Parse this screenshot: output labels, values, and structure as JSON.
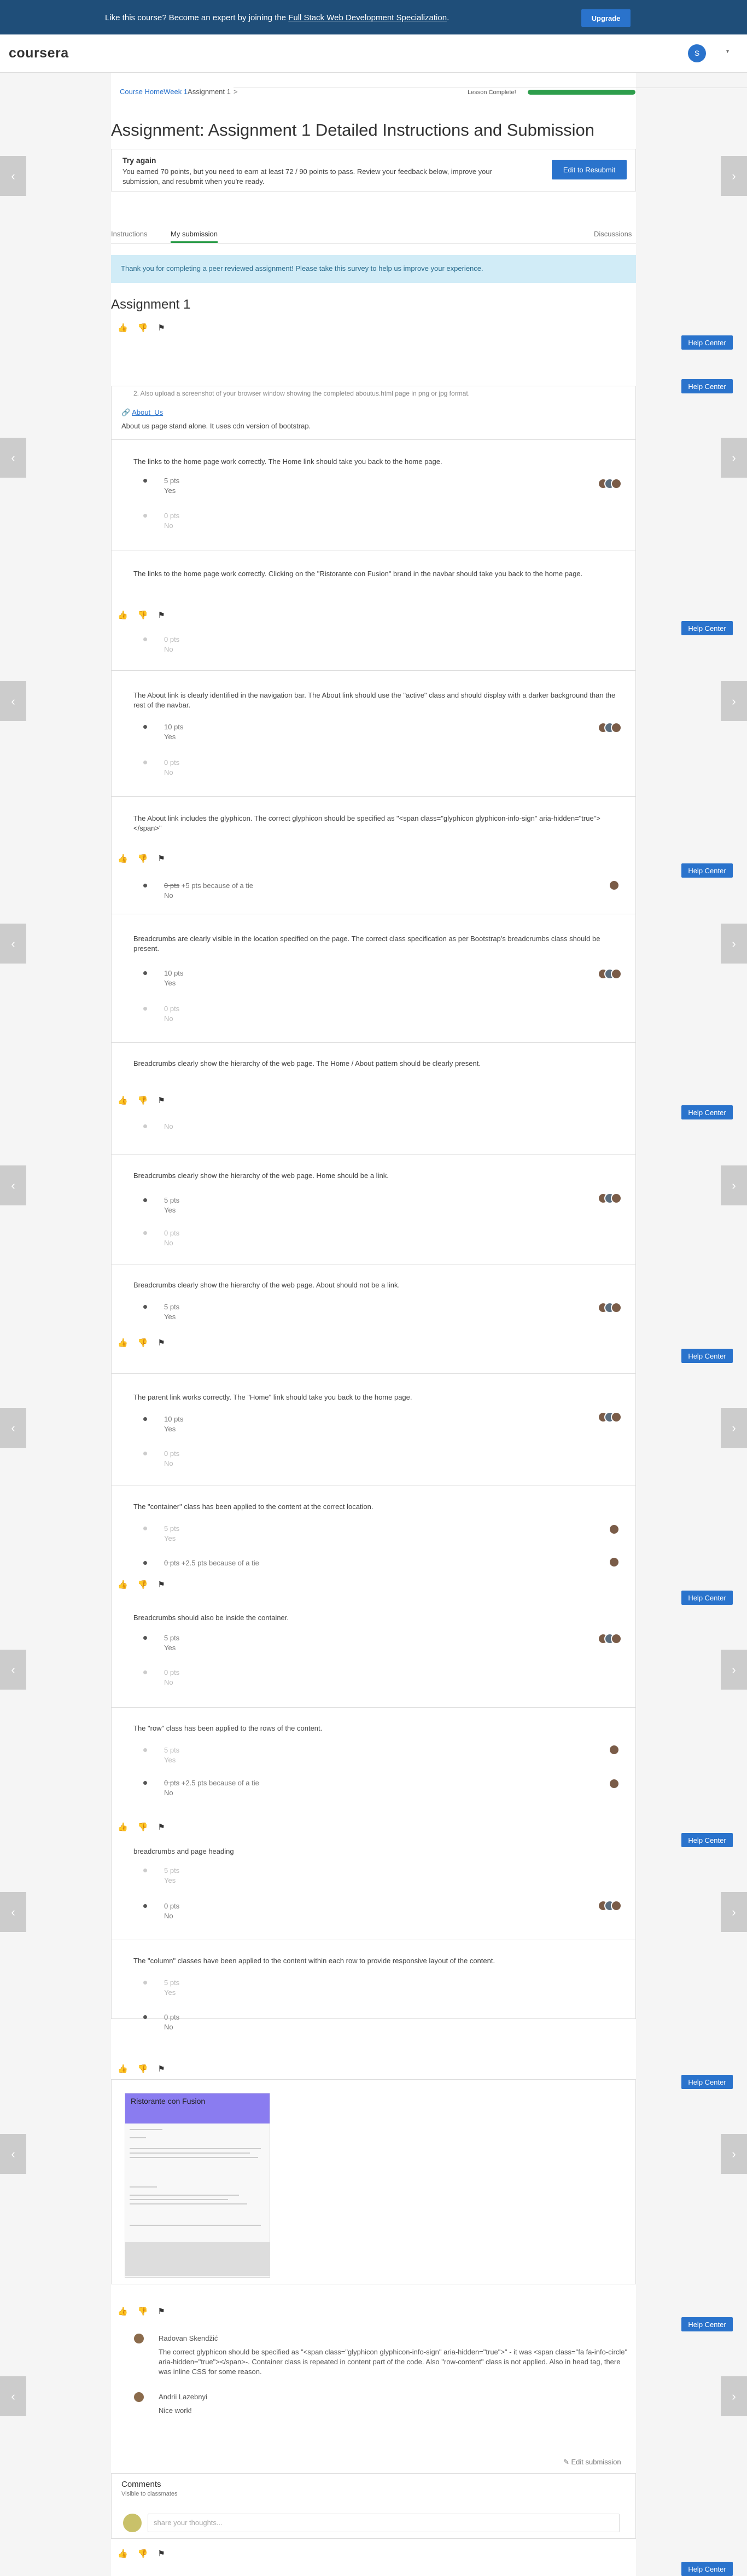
{
  "banner": {
    "text": "Like this course? Become an expert by joining the ",
    "link": "Full Stack Web Development Specialization",
    "end": ".",
    "upgrade": "Upgrade"
  },
  "nav": {
    "logo": "coursera",
    "avatar": "S",
    "caret": "▾"
  },
  "breadcrumb": {
    "home": "Course Home",
    "week": "Week 1",
    "current": "Assignment 1",
    "sep": ">"
  },
  "lesson": {
    "label": "Lesson Complete!",
    "progress": 1.0
  },
  "title": "Assignment: Assignment 1 Detailed Instructions and Submission",
  "tryagain": {
    "heading": "Try again",
    "body": "You earned 70 points, but you need to earn at least 72 / 90 points to pass. Review your feedback below, improve your submission, and resubmit when you're ready.",
    "button": "Edit to Resubmit"
  },
  "tabs": {
    "instructions": "Instructions",
    "submission": "My submission",
    "discussions": "Discussions"
  },
  "notice": "Thank you for completing a peer reviewed assignment! Please take this survey to help us improve your experience.",
  "section": "Assignment 1",
  "help": "Help Center",
  "toolbar": {
    "like": "👍",
    "dislike": "👎",
    "flag": "⚑"
  },
  "arrows": {
    "left": "‹",
    "right": "›"
  },
  "cut1": "2. Also upload a screenshot of your browser window showing the completed aboutus.html page in png or jpg format.",
  "file": {
    "name": "About_Us",
    "desc": "About us page stand alone. It uses cdn version of bootstrap."
  },
  "q": [
    "The links to the home page work correctly. The Home link should take you back to the home page.",
    "The links to the home page work correctly. Clicking on the \"Ristorante con Fusion\" brand in the navbar should take you back to the home page.",
    "The About link is clearly identified in the navigation bar. The About link should use the \"active\" class and should display with a darker background than the rest of the navbar.",
    "The About link includes the glyphicon. The correct glyphicon should be specified as \"<span class=\"glyphicon glyphicon-info-sign\" aria-hidden=\"true\"></span>\"",
    "Breadcrumbs are clearly visible in the location specified on the page. The correct class specification as per Bootstrap's breadcrumbs class should be present.",
    "Breadcrumbs clearly show the hierarchy of the web page. The Home / About pattern should be clearly present.",
    "Breadcrumbs clearly show the hierarchy of the web page. Home should be a link.",
    "Breadcrumbs clearly show the hierarchy of the web page. About should not be a link.",
    "The parent link works correctly. The \"Home\" link should take you back to the home page.",
    "The \"container\" class has been applied to the content at the correct location.",
    "Breadcrumbs should also be inside the container.",
    "The \"row\" class has been applied to the rows of the content.",
    "breadcrumbs and page heading",
    "The \"column\" classes have been applied to the content within each row to provide responsive layout of the content."
  ],
  "o": {
    "p10": "10 pts",
    "p5": "5 pts",
    "p0": "0 pts",
    "yes": "Yes",
    "no": "No",
    "tie5": " +5 pts because of a tie",
    "tie25": " +2.5 pts because of a tie"
  },
  "shot": {
    "brand": "Ristorante con Fusion"
  },
  "feedback": [
    {
      "name": "Radovan Skendžić",
      "text": "The correct glyphicon should be specified as \"<span class=\"glyphicon glyphicon-info-sign\" aria-hidden=\"true\">\" - it was <span class=\"fa fa-info-circle\" aria-hidden=\"true\"></span>-. Container class is repeated in content part of the code. Also \"row-content\" class is not applied. Also in head tag, there was inline CSS for some reason."
    },
    {
      "name": "Andrii Lazebnyi",
      "text": "Nice work!"
    }
  ],
  "edit": "✎ Edit submission",
  "comments": {
    "title": "Comments",
    "sub": "Visible to classmates",
    "placeholder": "share your thoughts..."
  }
}
